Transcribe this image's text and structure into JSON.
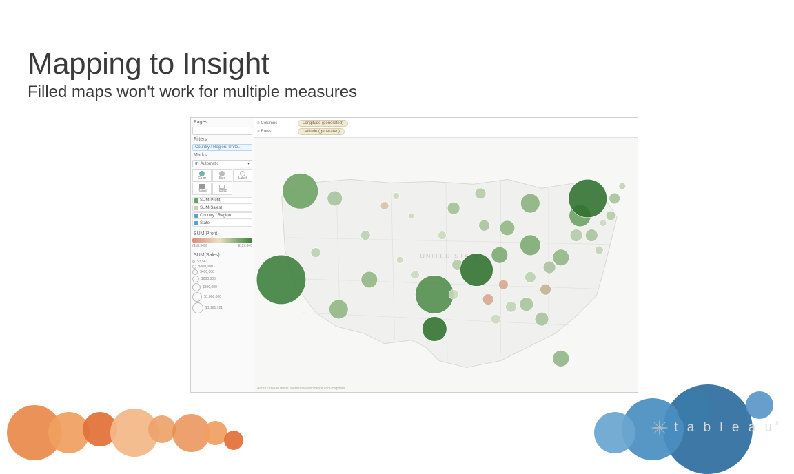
{
  "slide": {
    "title": "Mapping to Insight",
    "subtitle": "Filled maps won't work for multiple measures"
  },
  "shelves": {
    "columns_label": "Columns",
    "rows_label": "Rows",
    "columns_pill": "Longitude (generated)",
    "rows_pill": "Latitude (generated)"
  },
  "side": {
    "pages_label": "Pages",
    "filters_label": "Filters",
    "filter_pill": "Country / Region: Unite..",
    "marks_label": "Marks",
    "mark_type": "Automatic",
    "cells": {
      "color": "Color",
      "size": "Size",
      "label": "Label",
      "detail": "Detail",
      "tooltip": "Tooltip"
    },
    "mark_fields": [
      {
        "label": "SUM(Profit)",
        "color": "#6aa061"
      },
      {
        "label": "SUM(Sales)",
        "color": "#cfcab0"
      },
      {
        "label": "Country / Region",
        "color": "#5aa0d6"
      },
      {
        "label": "State",
        "color": "#5aa0d6"
      }
    ],
    "color_legend": {
      "title": "SUM(Profit)",
      "min": "($18,945)",
      "max": "$127,840"
    },
    "size_legend": {
      "title": "SUM(Sales)",
      "rows": [
        {
          "d": 4,
          "label": "$3,543"
        },
        {
          "d": 6,
          "label": "$300,000"
        },
        {
          "d": 8,
          "label": "$400,000"
        },
        {
          "d": 10,
          "label": "$600,000"
        },
        {
          "d": 12,
          "label": "$800,000"
        },
        {
          "d": 14,
          "label": "$1,000,000"
        },
        {
          "d": 16,
          "label": "$1,161,721"
        }
      ]
    }
  },
  "map": {
    "attribution": "About Tableau maps: www.tableausoftware.com/mapdata",
    "region_label": "UNITED STATES",
    "bubbles": [
      {
        "x": 0.12,
        "y": 0.2,
        "r": 26,
        "c": "#6aa061"
      },
      {
        "x": 0.21,
        "y": 0.23,
        "r": 11,
        "c": "#a6c29b"
      },
      {
        "x": 0.07,
        "y": 0.56,
        "r": 36,
        "c": "#3a7d3a"
      },
      {
        "x": 0.16,
        "y": 0.45,
        "r": 7,
        "c": "#b8cfae"
      },
      {
        "x": 0.22,
        "y": 0.68,
        "r": 14,
        "c": "#8fb583"
      },
      {
        "x": 0.29,
        "y": 0.38,
        "r": 7,
        "c": "#b8cfae"
      },
      {
        "x": 0.3,
        "y": 0.56,
        "r": 12,
        "c": "#8fb583"
      },
      {
        "x": 0.34,
        "y": 0.26,
        "r": 6,
        "c": "#d7bfa8"
      },
      {
        "x": 0.37,
        "y": 0.22,
        "r": 5,
        "c": "#c9d8be"
      },
      {
        "x": 0.41,
        "y": 0.3,
        "r": 4,
        "c": "#c9d8be"
      },
      {
        "x": 0.38,
        "y": 0.48,
        "r": 5,
        "c": "#c9d8be"
      },
      {
        "x": 0.42,
        "y": 0.54,
        "r": 6,
        "c": "#c9d8be"
      },
      {
        "x": 0.47,
        "y": 0.62,
        "r": 28,
        "c": "#4f8b4a"
      },
      {
        "x": 0.47,
        "y": 0.76,
        "r": 18,
        "c": "#2e6f2e"
      },
      {
        "x": 0.52,
        "y": 0.27,
        "r": 9,
        "c": "#9fbe94"
      },
      {
        "x": 0.49,
        "y": 0.38,
        "r": 6,
        "c": "#c9d8be"
      },
      {
        "x": 0.53,
        "y": 0.5,
        "r": 8,
        "c": "#b1caa6"
      },
      {
        "x": 0.52,
        "y": 0.62,
        "r": 7,
        "c": "#c9d8be"
      },
      {
        "x": 0.58,
        "y": 0.52,
        "r": 24,
        "c": "#2e6f2e"
      },
      {
        "x": 0.61,
        "y": 0.64,
        "r": 8,
        "c": "#d6a58f"
      },
      {
        "x": 0.6,
        "y": 0.34,
        "r": 8,
        "c": "#a6c29b"
      },
      {
        "x": 0.59,
        "y": 0.21,
        "r": 8,
        "c": "#b1caa6"
      },
      {
        "x": 0.64,
        "y": 0.46,
        "r": 12,
        "c": "#7ba971"
      },
      {
        "x": 0.65,
        "y": 0.58,
        "r": 7,
        "c": "#d6a58f"
      },
      {
        "x": 0.63,
        "y": 0.72,
        "r": 7,
        "c": "#c9d8be"
      },
      {
        "x": 0.67,
        "y": 0.67,
        "r": 8,
        "c": "#c0d3b5"
      },
      {
        "x": 0.66,
        "y": 0.35,
        "r": 11,
        "c": "#8fb583"
      },
      {
        "x": 0.72,
        "y": 0.25,
        "r": 14,
        "c": "#87b07c"
      },
      {
        "x": 0.72,
        "y": 0.42,
        "r": 15,
        "c": "#7ba971"
      },
      {
        "x": 0.72,
        "y": 0.55,
        "r": 8,
        "c": "#b8cfae"
      },
      {
        "x": 0.71,
        "y": 0.66,
        "r": 10,
        "c": "#a6c29b"
      },
      {
        "x": 0.75,
        "y": 0.72,
        "r": 10,
        "c": "#a6c29b"
      },
      {
        "x": 0.76,
        "y": 0.6,
        "r": 8,
        "c": "#c1b08f"
      },
      {
        "x": 0.77,
        "y": 0.51,
        "r": 9,
        "c": "#a6c29b"
      },
      {
        "x": 0.8,
        "y": 0.47,
        "r": 12,
        "c": "#8fb583"
      },
      {
        "x": 0.8,
        "y": 0.88,
        "r": 12,
        "c": "#8fb583"
      },
      {
        "x": 0.84,
        "y": 0.38,
        "r": 9,
        "c": "#b1caa6"
      },
      {
        "x": 0.85,
        "y": 0.3,
        "r": 16,
        "c": "#6aa061"
      },
      {
        "x": 0.87,
        "y": 0.23,
        "r": 28,
        "c": "#2e6f2e"
      },
      {
        "x": 0.88,
        "y": 0.38,
        "r": 9,
        "c": "#a6c29b"
      },
      {
        "x": 0.9,
        "y": 0.44,
        "r": 6,
        "c": "#c0d3b5"
      },
      {
        "x": 0.94,
        "y": 0.23,
        "r": 8,
        "c": "#a6c29b"
      },
      {
        "x": 0.96,
        "y": 0.18,
        "r": 5,
        "c": "#c0d3b5"
      },
      {
        "x": 0.93,
        "y": 0.3,
        "r": 7,
        "c": "#b1caa6"
      },
      {
        "x": 0.91,
        "y": 0.33,
        "r": 5,
        "c": "#c9d8be"
      }
    ]
  },
  "footer": {
    "brand": "t a b l e a u"
  }
}
